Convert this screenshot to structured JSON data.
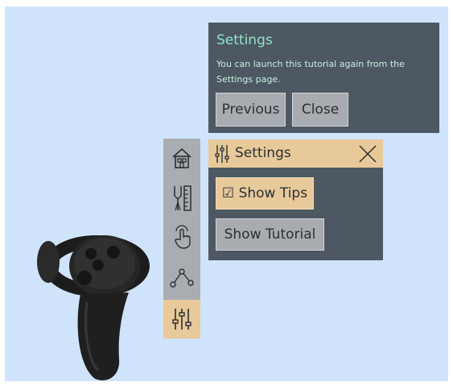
{
  "tooltip": {
    "title": "Settings",
    "text": "You can launch this tutorial again from the Settings page.",
    "previous_label": "Previous",
    "close_label": "Close"
  },
  "toolbar": {
    "items": [
      {
        "icon": "home-icon"
      },
      {
        "icon": "tools-icon"
      },
      {
        "icon": "hand-pointer-icon"
      },
      {
        "icon": "path-nodes-icon"
      },
      {
        "icon": "sliders-icon",
        "active": true
      }
    ]
  },
  "settings_panel": {
    "title": "Settings",
    "show_tips_label": "☑ Show Tips",
    "show_tutorial_label": "Show Tutorial"
  },
  "colors": {
    "background": "#cfe4fb",
    "panel": "#4d5862",
    "accent": "#e8c99a",
    "button": "#a8acb0",
    "tooltip_title": "#8fe3c7"
  }
}
